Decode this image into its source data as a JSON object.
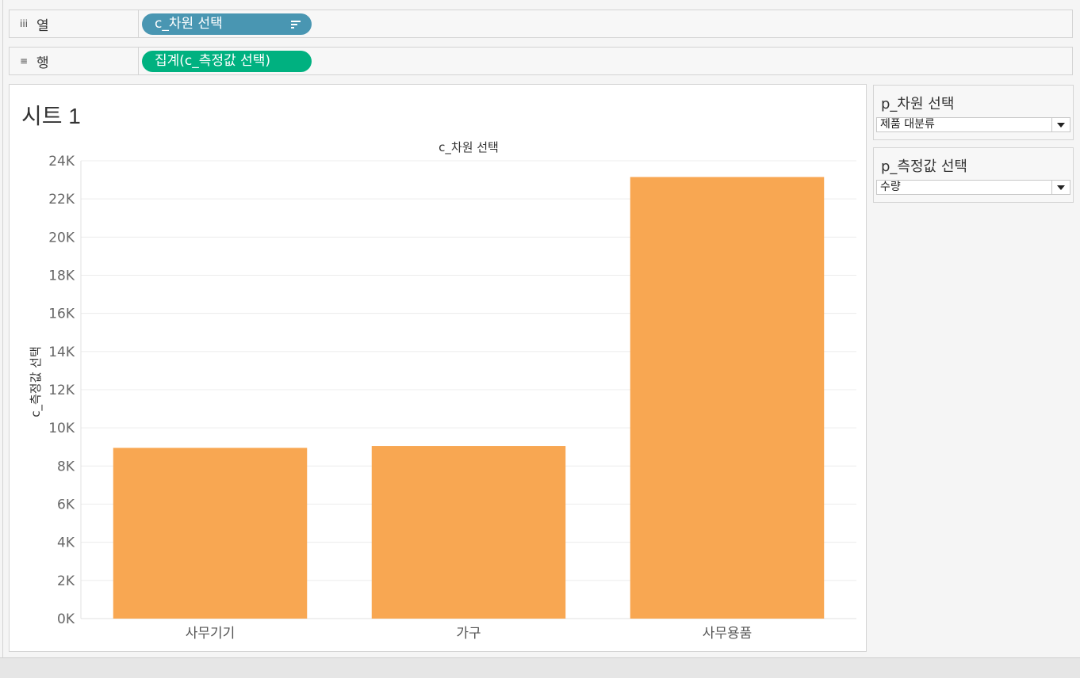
{
  "shelves": {
    "columns": {
      "label": "열",
      "icon": "columns-icon",
      "pill": "c_차원 선택",
      "pill_color": "#4996b2"
    },
    "rows": {
      "label": "행",
      "icon": "rows-icon",
      "pill": "집계(c_측정값 선택)",
      "pill_color": "#00b180"
    }
  },
  "sheet": {
    "title": "시트 1"
  },
  "parameters": [
    {
      "title": "p_차원 선택",
      "value": "제품 대분류"
    },
    {
      "title": "p_측정값 선택",
      "value": "수량"
    }
  ],
  "chart_data": {
    "type": "bar",
    "title": "c_차원 선택",
    "ylabel": "c_측정값 선택",
    "xlabel": "",
    "categories": [
      "사무기기",
      "가구",
      "사무용품"
    ],
    "values": [
      8950,
      9050,
      23150
    ],
    "ylim": [
      0,
      24000
    ],
    "yticks": [
      0,
      2000,
      4000,
      6000,
      8000,
      10000,
      12000,
      14000,
      16000,
      18000,
      20000,
      22000,
      24000
    ],
    "ytick_labels": [
      "0K",
      "2K",
      "4K",
      "6K",
      "8K",
      "10K",
      "12K",
      "14K",
      "16K",
      "18K",
      "20K",
      "22K",
      "24K"
    ],
    "bar_color": "#f8a752",
    "grid": true
  }
}
